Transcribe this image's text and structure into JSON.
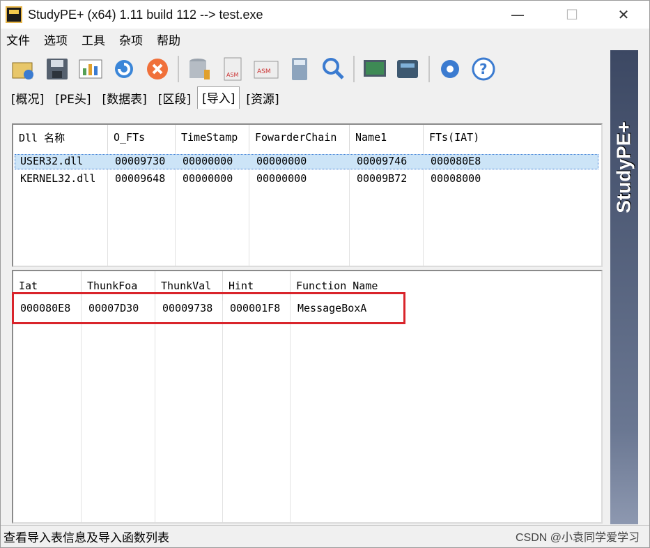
{
  "window": {
    "title": "StudyPE+ (x64) 1.11 build 112  --> test.exe"
  },
  "menu": [
    "文件",
    "选项",
    "工具",
    "杂项",
    "帮助"
  ],
  "toolbar_icons": [
    "open-icon",
    "save-icon",
    "chart-icon",
    "refresh-icon",
    "close-file-icon",
    "database-icon",
    "asm-doc-icon",
    "asm-icon",
    "calculator-icon",
    "search-icon",
    "monitor-icon",
    "device-icon",
    "settings-icon",
    "help-icon"
  ],
  "tabs": [
    "[概况]",
    "[PE头]",
    "[数据表]",
    "[区段]",
    "[导入]",
    "[资源]"
  ],
  "active_tab": 4,
  "sidebar_brand": "StudyPE+",
  "dll_table": {
    "headers": [
      "Dll 名称",
      "O_FTs",
      "TimeStamp",
      "FowarderChain",
      "Name1",
      "FTs(IAT)"
    ],
    "rows": [
      [
        "USER32.dll",
        "00009730",
        "00000000",
        "00000000",
        "00009746",
        "000080E8"
      ],
      [
        "KERNEL32.dll",
        "00009648",
        "00000000",
        "00000000",
        "00009B72",
        "00008000"
      ]
    ],
    "selected_row": 0
  },
  "func_table": {
    "headers": [
      "Iat",
      "ThunkFoa",
      "ThunkVal",
      "Hint",
      "Function Name"
    ],
    "rows": [
      [
        "000080E8",
        "00007D30",
        "00009738",
        "000001F8",
        "MessageBoxA"
      ]
    ]
  },
  "status": {
    "text": "查看导入表信息及导入函数列表"
  },
  "watermark": "CSDN @小袁同学爱学习",
  "colors": {
    "highlight": "#d9242b",
    "selection": "#cce4f7",
    "sidebar": "#3c4863"
  }
}
